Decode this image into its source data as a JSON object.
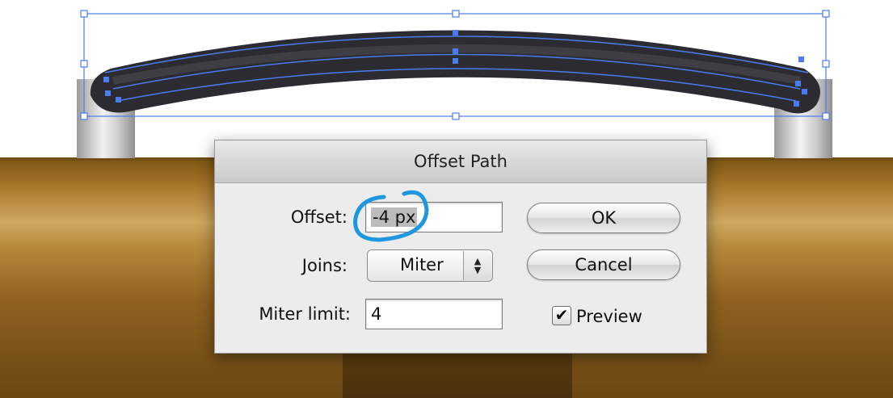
{
  "dialog": {
    "title": "Offset Path",
    "offset": {
      "label": "Offset:",
      "value": "-4 px"
    },
    "joins": {
      "label": "Joins:",
      "value": "Miter"
    },
    "miter_limit": {
      "label": "Miter limit:",
      "value": "4"
    },
    "ok_label": "OK",
    "cancel_label": "Cancel",
    "preview": {
      "label": "Preview",
      "checked": true
    }
  },
  "colors": {
    "selection_accent": "#4a7bf0",
    "annotation_circle": "#1f97e0",
    "handle_fill": "#2c2b31"
  },
  "icons": [
    "stepper-arrows-icon",
    "checkmark-icon"
  ]
}
